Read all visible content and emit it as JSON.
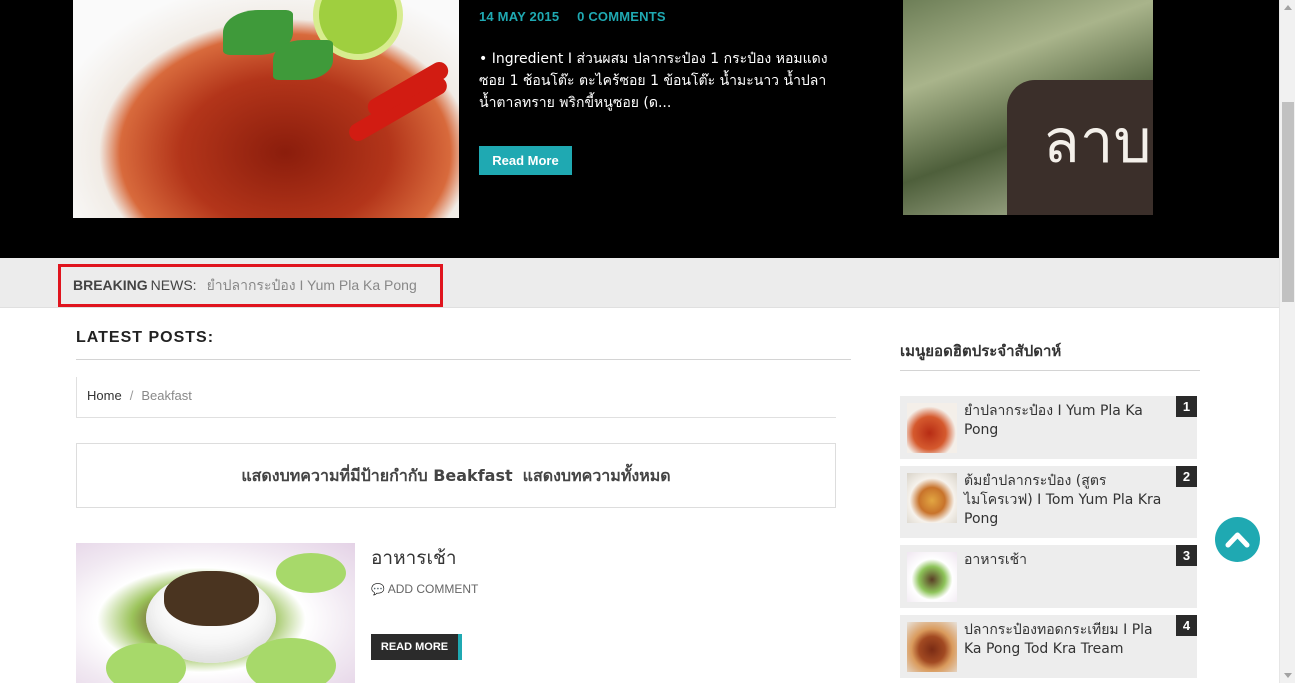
{
  "hero": {
    "date": "14 MAY 2015",
    "comments": "0 COMMENTS",
    "excerpt": "• Ingredient I ส่วนผสม ปลากระป๋อง 1 กระป๋อง หอมแดงซอย 1 ช้อนโต๊ะ ตะไคร้ซอย 1 ข้อนโต๊ะ น้ำมะนาว น้ำปลา น้ำตาลทราย พริกขี้หนูซอย (ด...",
    "read_more": "Read More",
    "side_image_text": "ลาบเ"
  },
  "breaking": {
    "label_bold": "BREAKING",
    "label": "NEWS:",
    "text": "ยำปลากระป๋อง I Yum Pla Ka Pong"
  },
  "main": {
    "heading": "LATEST POSTS:",
    "breadcrumb": {
      "home": "Home",
      "separator": "/",
      "current": "Beakfast"
    },
    "label_notice": "แสดงบทความที่มีป้ายกำกับ Beakfast",
    "show_all": "แสดงบทความทั้งหมด",
    "post": {
      "title": "อาหารเช้า",
      "comments": "ADD COMMENT",
      "read_more": "READ MORE"
    }
  },
  "sidebar": {
    "title": "เมนูยอดฮิตประจำสัปดาห์",
    "items": [
      {
        "rank": "1",
        "title": "ยำปลากระป๋อง I Yum Pla Ka Pong"
      },
      {
        "rank": "2",
        "title": "ต้มยำปลากระป๋อง (สูตร ไมโครเวฟ) I Tom Yum Pla Kra Pong"
      },
      {
        "rank": "3",
        "title": "อาหารเช้า"
      },
      {
        "rank": "4",
        "title": "ปลากระป๋องทอดกระเทียม I Pla Ka Pong Tod Kra Tream"
      }
    ]
  },
  "colors": {
    "accent": "#1fa9b2",
    "highlight_border": "#e0141e",
    "dark": "#2b2b2b"
  }
}
